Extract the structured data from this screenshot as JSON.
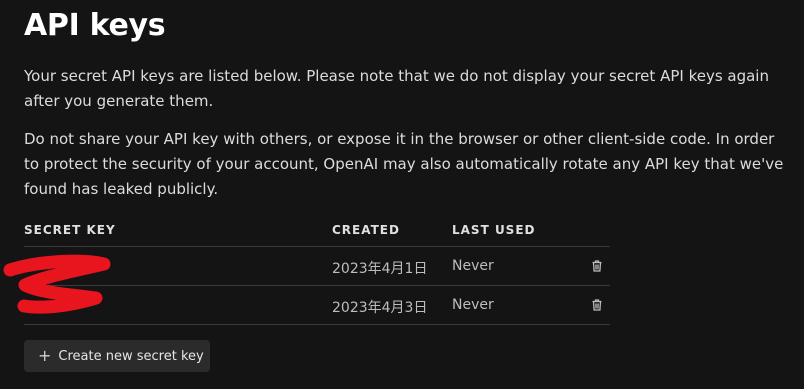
{
  "page": {
    "title": "API keys",
    "intro": "Your secret API keys are listed below. Please note that we do not display your secret API keys again after you generate them.",
    "warning": "Do not share your API key with others, or expose it in the browser or other client-side code. In order to protect the security of your account, OpenAI may also automatically rotate any API key that we've found has leaked publicly."
  },
  "table": {
    "headers": {
      "secret_key": "SECRET KEY",
      "created": "CREATED",
      "last_used": "LAST USED"
    },
    "rows": [
      {
        "key": "",
        "created": "2023年4月1日",
        "last_used": "Never",
        "delete_icon": "trash-icon"
      },
      {
        "key": "",
        "created": "2023年4月3日",
        "last_used": "Never",
        "delete_icon": "trash-icon"
      }
    ]
  },
  "actions": {
    "create_label": "Create new secret key",
    "create_icon": "plus-icon"
  },
  "colors": {
    "background": "#141414",
    "redaction": "#e8141e"
  }
}
